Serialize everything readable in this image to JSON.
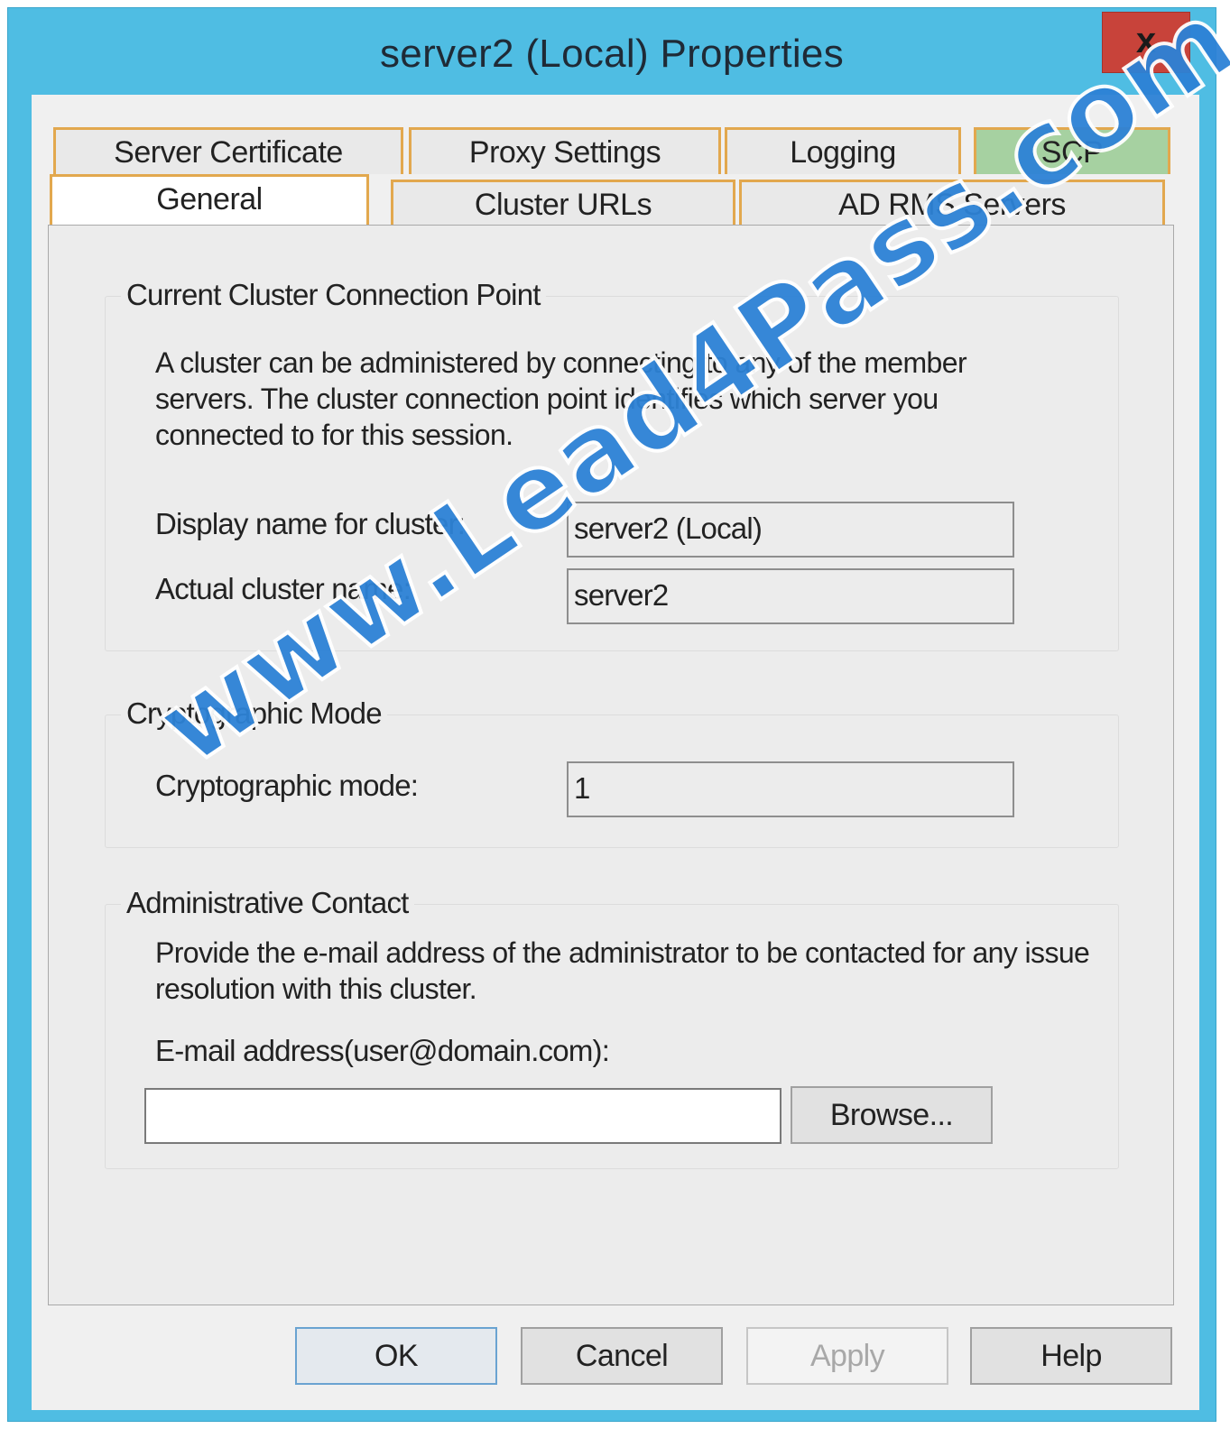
{
  "window": {
    "title": "server2 (Local) Properties",
    "close_label": "x"
  },
  "tabs": {
    "row1": [
      {
        "label": "Server Certificate"
      },
      {
        "label": "Proxy Settings"
      },
      {
        "label": "Logging"
      },
      {
        "label": "SCP"
      }
    ],
    "row2": [
      {
        "label": "General",
        "selected": true
      },
      {
        "label": "Cluster URLs"
      },
      {
        "label": "AD RMS Servers"
      }
    ]
  },
  "general": {
    "connection_point": {
      "title": "Current Cluster Connection Point",
      "description": "A cluster can be administered by connecting to any of the member servers. The cluster connection point identifies which server you connected to for this session.",
      "display_name_label": "Display name for cluster:",
      "display_name_value": "server2 (Local)",
      "actual_name_label": "Actual cluster name:",
      "actual_name_value": "server2"
    },
    "crypto": {
      "title": "Cryptographic Mode",
      "mode_label": "Cryptographic mode:",
      "mode_value": "1"
    },
    "admin_contact": {
      "title": "Administrative Contact",
      "description": "Provide the e-mail address of the administrator to be contacted for any issue resolution with this cluster.",
      "email_label": "E-mail address(user@domain.com):",
      "email_value": "",
      "browse_label": "Browse..."
    }
  },
  "buttons": {
    "ok": "OK",
    "cancel": "Cancel",
    "apply": "Apply",
    "help": "Help"
  },
  "watermark": "www.Lead4Pass.com",
  "colors": {
    "frame": "#4fbde3",
    "close": "#c8433a",
    "tab_highlight": "#e2a84e",
    "scp_tab": "#a6d1a1",
    "watermark": "#2d82d6"
  }
}
